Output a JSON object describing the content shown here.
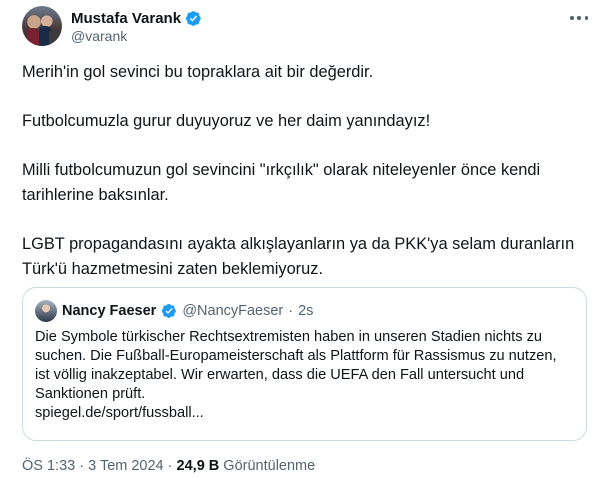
{
  "author": {
    "name": "Mustafa Varank",
    "handle": "@varank",
    "verified_icon": "verified-badge-icon",
    "avatar_icon": "group-photo-avatar"
  },
  "more_icon": "more-options-icon",
  "tweet": {
    "paragraphs": [
      "Merih'in gol sevinci bu topraklara ait bir değerdir.",
      "Futbolcumuzla gurur duyuyoruz ve her daim yanındayız!",
      "Milli futbolcumuzun gol sevincini \"ırkçılık\" olarak niteleyenler önce kendi tarihlerine baksınlar.",
      "LGBT propagandasını ayakta alkışlayanların ya da PKK'ya selam duranların Türk'ü hazmetmesini zaten beklemiyoruz."
    ]
  },
  "quoted_tweet": {
    "name": "Nancy Faeser",
    "handle": "@NancyFaeser",
    "separator": "·",
    "time": "2s",
    "text": "Die Symbole türkischer Rechtsextremisten haben in unseren Stadien nichts zu suchen. Die Fußball-Europameisterschaft als Plattform für Rassismus zu nutzen, ist völlig inakzeptabel. Wir erwarten, dass die UEFA den Fall untersucht und Sanktionen prüft.",
    "link": "spiegel.de/sport/fussball..."
  },
  "meta": {
    "time": "ÖS 1:33",
    "separator": "·",
    "date": "3 Tem 2024",
    "views_count": "24,9 B",
    "views_label": "Görüntülenme"
  },
  "colors": {
    "text": "#0f1419",
    "secondary": "#536471",
    "verified": "#1d9bf0",
    "border": "#cfd9de"
  }
}
